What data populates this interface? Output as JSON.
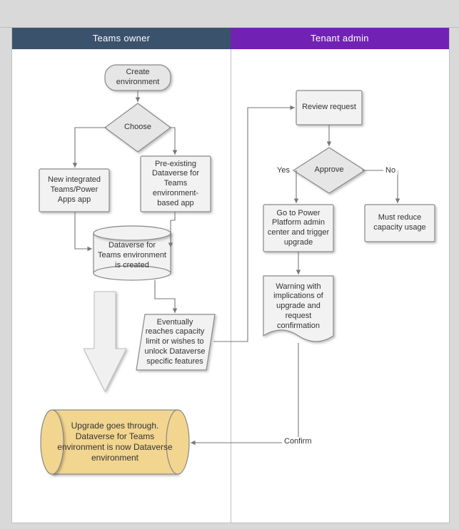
{
  "lanes": {
    "left": "Teams owner",
    "right": "Tenant admin"
  },
  "nodes": {
    "create": "Create environment",
    "choose": "Choose",
    "newint": "New integrated Teams/Power Apps app",
    "preexist": "Pre-existing Dataverse for Teams environment-based app",
    "dvcreated": "Dataverse for Teams environment is created",
    "eventually": "Eventually reaches capacity limit or wishes to unlock Dataverse specific features",
    "upgrade": "Upgrade goes through. Dataverse for Teams environment is now Dataverse environment",
    "review": "Review request",
    "approve": "Approve",
    "yes": "Yes",
    "no": "No",
    "goto": "Go to Power Platform admin center and trigger upgrade",
    "mustreduce": "Must reduce capacity usage",
    "warning": "Warning with implications of upgrade and request confirmation",
    "confirm": "Confirm"
  }
}
